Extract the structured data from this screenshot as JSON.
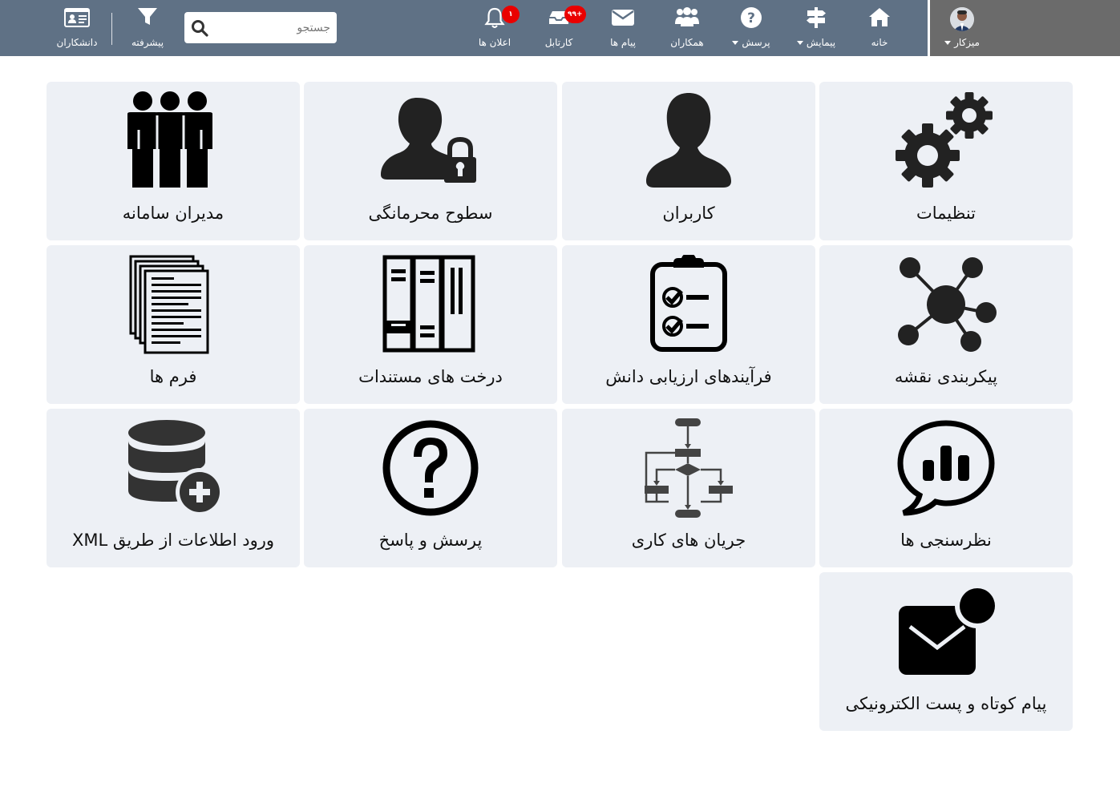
{
  "topbar": {
    "user": {
      "name": "میزکار"
    },
    "nav": {
      "home": "خانه",
      "survey": "پیمایش",
      "question": "پرسش",
      "colleagues": "همکاران",
      "messages": "پیام ها",
      "cartable": "کارتابل",
      "notifications": "اعلان ها",
      "advanced": "پیشرفته",
      "students": "دانشکاران"
    },
    "badges": {
      "cartable": "۹۹+",
      "notifications": "۱"
    },
    "search": {
      "placeholder": "جستجو"
    }
  },
  "tiles": [
    {
      "label": "تنظیمات",
      "icon": "gears-icon"
    },
    {
      "label": "کاربران",
      "icon": "user-icon"
    },
    {
      "label": "سطوح محرمانگی",
      "icon": "user-lock-icon"
    },
    {
      "label": "مدیران سامانه",
      "icon": "group-icon"
    },
    {
      "label": "پیکربندی نقشه",
      "icon": "network-icon"
    },
    {
      "label": "فرآیندهای ارزیابی دانش",
      "icon": "clipboard-check-icon"
    },
    {
      "label": "درخت های مستندات",
      "icon": "binders-icon"
    },
    {
      "label": "فرم ها",
      "icon": "documents-icon"
    },
    {
      "label": "نظرسنجی ها",
      "icon": "poll-bubble-icon"
    },
    {
      "label": "جریان های کاری",
      "icon": "flowchart-icon"
    },
    {
      "label": "پرسش و پاسخ",
      "icon": "question-circle-icon"
    },
    {
      "label": "ورود اطلاعات از طریق XML",
      "icon": "database-add-icon"
    },
    {
      "label": "پیام کوتاه و پست الکترونیکی",
      "icon": "envelope-dot-icon"
    }
  ],
  "colors": {
    "topbar": "#5f7185",
    "user_block": "#6b6b6b",
    "tile_bg": "#edf0f5",
    "badge": "#ea0000",
    "icon": "#111111"
  }
}
